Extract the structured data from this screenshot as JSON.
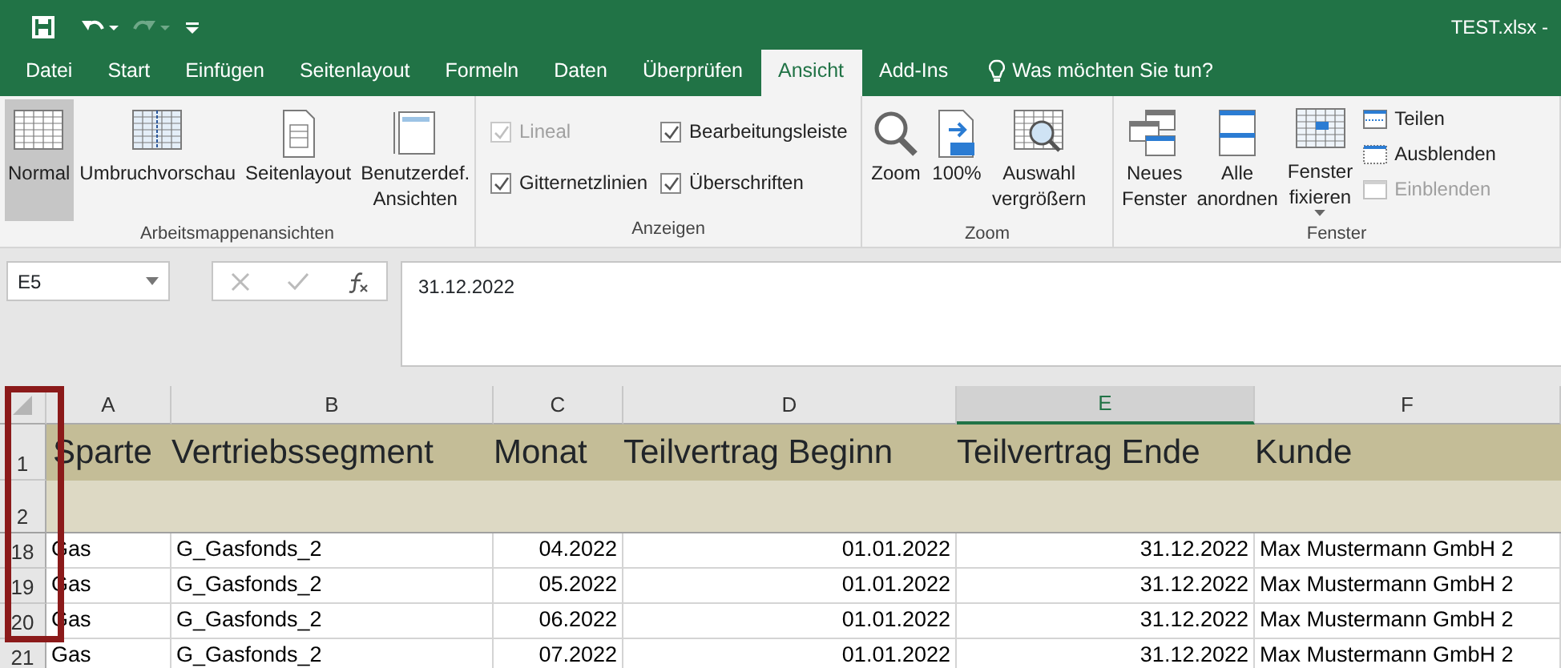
{
  "title_bar": {
    "file_title": "TEST.xlsx -"
  },
  "tabs": [
    {
      "label": "Datei",
      "selected": false
    },
    {
      "label": "Start",
      "selected": false
    },
    {
      "label": "Einfügen",
      "selected": false
    },
    {
      "label": "Seitenlayout",
      "selected": false
    },
    {
      "label": "Formeln",
      "selected": false
    },
    {
      "label": "Daten",
      "selected": false
    },
    {
      "label": "Überprüfen",
      "selected": false
    },
    {
      "label": "Ansicht",
      "selected": true
    },
    {
      "label": "Add-Ins",
      "selected": false
    }
  ],
  "tell_me": {
    "placeholder": "Was möchten Sie tun?"
  },
  "ribbon": {
    "groups": [
      {
        "label": "Arbeitsmappenansichten",
        "items": [
          {
            "kind": "large",
            "label": "Normal",
            "selected": true
          },
          {
            "kind": "large",
            "label": "Umbruchvorschau",
            "selected": false
          },
          {
            "kind": "large",
            "label": "Seitenlayout",
            "selected": false
          },
          {
            "kind": "large",
            "label": "Benutzerdef.\nAnsichten",
            "selected": false
          }
        ]
      },
      {
        "label": "Anzeigen",
        "items": [
          {
            "kind": "check",
            "label": "Lineal",
            "checked": true,
            "disabled": true
          },
          {
            "kind": "check",
            "label": "Gitternetzlinien",
            "checked": true,
            "disabled": false
          },
          {
            "kind": "check",
            "label": "Bearbeitungsleiste",
            "checked": true,
            "disabled": false
          },
          {
            "kind": "check",
            "label": "Überschriften",
            "checked": true,
            "disabled": false
          }
        ]
      },
      {
        "label": "Zoom",
        "items": [
          {
            "kind": "large",
            "label": "Zoom",
            "selected": false
          },
          {
            "kind": "large",
            "label": "100%",
            "selected": false
          },
          {
            "kind": "large",
            "label": "Auswahl\nvergrößern",
            "selected": false
          }
        ]
      },
      {
        "label": "Fenster",
        "items": [
          {
            "kind": "large",
            "label": "Neues\nFenster",
            "selected": false
          },
          {
            "kind": "large",
            "label": "Alle\nanordnen",
            "selected": false
          },
          {
            "kind": "large",
            "label": "Fenster\nfixieren",
            "selected": false,
            "dropdown": true
          },
          {
            "kind": "small",
            "label": "Teilen",
            "disabled": false
          },
          {
            "kind": "small",
            "label": "Ausblenden",
            "disabled": false
          },
          {
            "kind": "small",
            "label": "Einblenden",
            "disabled": true
          }
        ]
      }
    ]
  },
  "formula_bar": {
    "name_box": "E5",
    "value": "31.12.2022"
  },
  "sheet": {
    "columns": [
      {
        "label": "A",
        "selected": false,
        "kind": "text"
      },
      {
        "label": "B",
        "selected": false,
        "kind": "text"
      },
      {
        "label": "C",
        "selected": false,
        "kind": "number"
      },
      {
        "label": "D",
        "selected": false,
        "kind": "number"
      },
      {
        "label": "E",
        "selected": true,
        "kind": "number"
      },
      {
        "label": "F",
        "selected": false,
        "kind": "text"
      }
    ],
    "header_row": {
      "number": "1",
      "cells": [
        "Sparte",
        "Vertriebssegment",
        "Monat",
        "Teilvertrag Beginn",
        "Teilvertrag Ende",
        "Kunde"
      ]
    },
    "blank_row": {
      "number": "2"
    },
    "rows": [
      {
        "number": "18",
        "cells": [
          "Gas",
          "G_Gasfonds_2",
          "04.2022",
          "01.01.2022",
          "31.12.2022",
          "Max Mustermann GmbH 2"
        ]
      },
      {
        "number": "19",
        "cells": [
          "Gas",
          "G_Gasfonds_2",
          "05.2022",
          "01.01.2022",
          "31.12.2022",
          "Max Mustermann GmbH 2"
        ]
      },
      {
        "number": "20",
        "cells": [
          "Gas",
          "G_Gasfonds_2",
          "06.2022",
          "01.01.2022",
          "31.12.2022",
          "Max Mustermann GmbH 2"
        ]
      },
      {
        "number": "21",
        "cells": [
          "Gas",
          "G_Gasfonds_2",
          "07.2022",
          "01.01.2022",
          "31.12.2022",
          "Max Mustermann GmbH 2"
        ]
      }
    ]
  }
}
